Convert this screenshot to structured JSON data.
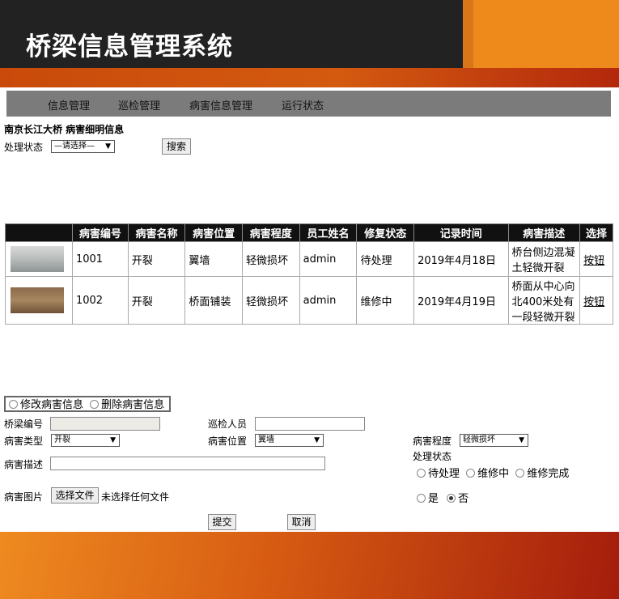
{
  "header": {
    "title": "桥梁信息管理系统"
  },
  "nav": {
    "items": [
      "信息管理",
      "巡检管理",
      "病害信息管理",
      "运行状态"
    ]
  },
  "page": {
    "bridge_title": "南京长江大桥 病害细明信息"
  },
  "filter": {
    "label": "处理状态",
    "select_value": "—请选择—",
    "search_label": "搜索"
  },
  "table": {
    "headers": [
      "",
      "病害编号",
      "病害名称",
      "病害位置",
      "病害程度",
      "员工姓名",
      "修复状态",
      "记录时间",
      "病害描述",
      "选择"
    ],
    "rows": [
      {
        "id": "1001",
        "name": "开裂",
        "location": "翼墙",
        "severity": "轻微损坏",
        "staff": "admin",
        "status": "待处理",
        "time": "2019年4月18日",
        "desc": "桥台侧边混凝土轻微开裂",
        "action": "按钮"
      },
      {
        "id": "1002",
        "name": "开裂",
        "location": "桥面铺装",
        "severity": "轻微损坏",
        "staff": "admin",
        "status": "维修中",
        "time": "2019年4月19日",
        "desc": "桥面从中心向北400米处有一段轻微开裂",
        "action": "按钮"
      }
    ]
  },
  "form": {
    "mode_modify": "修改病害信息",
    "mode_delete": "删除病害信息",
    "bridge_no_label": "桥梁编号",
    "inspector_label": "巡检人员",
    "type_label": "病害类型",
    "type_value": "开裂",
    "location_label": "病害位置",
    "location_value": "翼墙",
    "severity_label": "病害程度",
    "severity_value": "轻微损坏",
    "desc_label": "病害描述",
    "status_label": "处理状态",
    "status_options": [
      "待处理",
      "维修中",
      "维修完成"
    ],
    "image_label": "病害图片",
    "choose_file": "选择文件",
    "no_file": "未选择任何文件",
    "yes": "是",
    "no": "否",
    "submit": "提交",
    "cancel": "取消"
  }
}
